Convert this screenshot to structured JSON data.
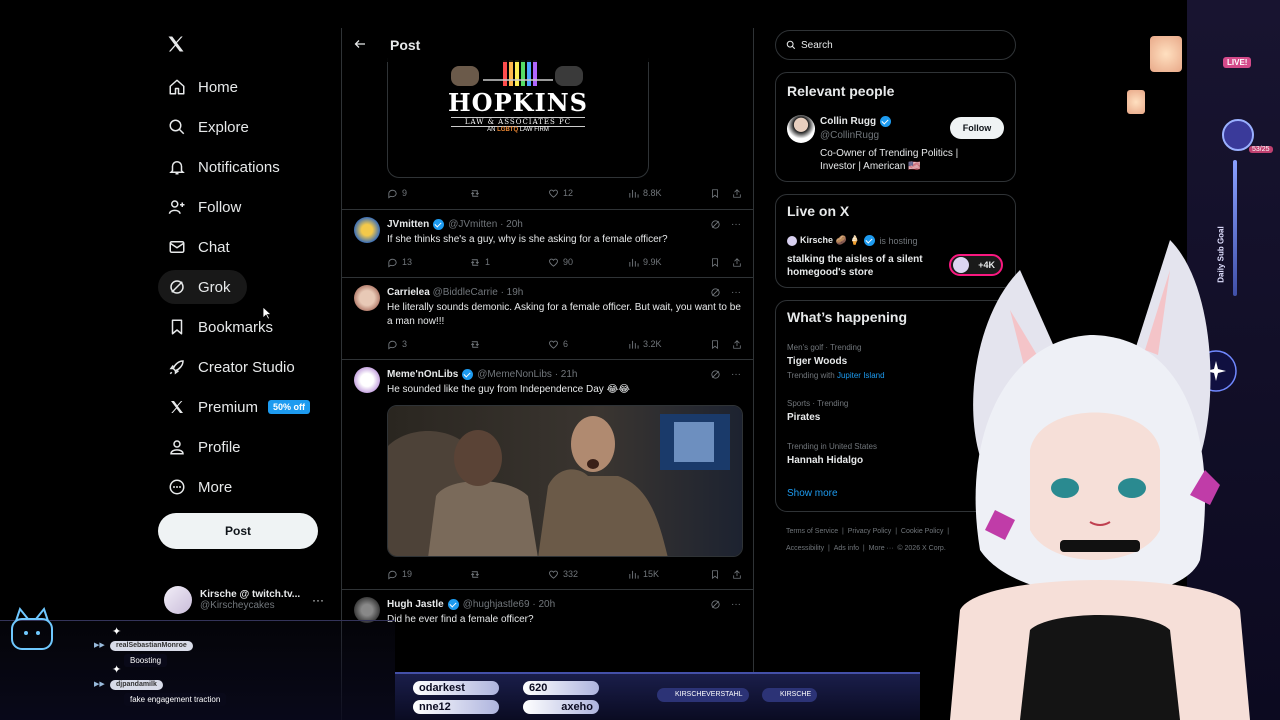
{
  "nav": {
    "items": [
      {
        "label": "Home",
        "icon": "home-icon"
      },
      {
        "label": "Explore",
        "icon": "search-icon"
      },
      {
        "label": "Notifications",
        "icon": "bell-icon"
      },
      {
        "label": "Follow",
        "icon": "add-person-icon"
      },
      {
        "label": "Chat",
        "icon": "envelope-icon"
      },
      {
        "label": "Grok",
        "icon": "grok-icon"
      },
      {
        "label": "Bookmarks",
        "icon": "bookmark-icon"
      },
      {
        "label": "Creator Studio",
        "icon": "rocket-icon"
      },
      {
        "label": "Premium",
        "icon": "x-logo-icon",
        "badge": "50% off"
      },
      {
        "label": "Profile",
        "icon": "person-icon"
      },
      {
        "label": "More",
        "icon": "more-circle-icon"
      }
    ],
    "post_label": "Post",
    "account": {
      "name": "Kirsche @ twitch.tv...",
      "handle": "@Kirscheycakes",
      "more": "···"
    }
  },
  "main": {
    "title": "Post",
    "hero_logo": {
      "word": "HOPKINS",
      "sub": "LAW & ASSOCIATES PC",
      "tag_a": "AN ",
      "tag_b": "LGBTQ",
      "tag_c": " LAW FIRM"
    },
    "hero_actions": {
      "replies": "9",
      "reposts": "",
      "likes": "12",
      "views": "8.8K"
    },
    "tweets": [
      {
        "name": "JVmitten",
        "handle": "@JVmitten",
        "time": "· 20h",
        "text": "If she thinks she's a guy, why is she asking for a female officer?",
        "replies": "13",
        "reposts": "1",
        "likes": "90",
        "views": "9.9K"
      },
      {
        "name": "Carrielea",
        "handle": "@BiddleCarrie",
        "time": "· 19h",
        "text": "He literally sounds demonic. Asking for a female officer. But wait, you want to be a man now!!!",
        "replies": "3",
        "reposts": "",
        "likes": "6",
        "views": "3.2K"
      },
      {
        "name": "Meme'nOnLibs",
        "handle": "@MemeNonLibs",
        "time": "· 21h",
        "text": "He sounded like the guy from Independence Day 😂😂",
        "replies": "19",
        "reposts": "",
        "likes": "332",
        "views": "15K"
      },
      {
        "name": "Hugh Jastle",
        "handle": "@hughjastle69",
        "time": "· 20h",
        "text": "Did he ever find a female officer?"
      }
    ]
  },
  "side": {
    "search_placeholder": "Search",
    "relevant": {
      "title": "Relevant people",
      "name": "Collin Rugg",
      "handle": "@CollinRugg",
      "follow": "Follow",
      "bio": "Co-Owner of Trending Politics | Investor | American 🇺🇸"
    },
    "live": {
      "title": "Live on X",
      "host": "Kirsche 🥔 🍦",
      "is_hosting": "is hosting",
      "stream": "stalking the aisles of a silent homegood's store",
      "count": "+4K"
    },
    "happening": {
      "title": "What’s happening",
      "trends": [
        {
          "cat": "Men's golf · Trending",
          "name": "Tiger Woods",
          "with_label": "Trending with ",
          "with_link": "Jupiter Island"
        },
        {
          "cat": "Sports · Trending",
          "name": "Pirates"
        },
        {
          "cat": "Trending in United States",
          "name": "Hannah Hidalgo"
        }
      ],
      "show_more": "Show more"
    },
    "footer": [
      "Terms of Service",
      "|",
      "Privacy Policy",
      "|",
      "Cookie Policy",
      "|",
      "Accessibility",
      "|",
      "Ads info",
      "|",
      "More ···",
      "© 2026 X Corp."
    ]
  },
  "overlay": {
    "chat": [
      {
        "user": "realSebastianMonroe",
        "msg": "Boosting"
      },
      {
        "user": "djpandamilk",
        "msg": "fake engagement traction"
      }
    ],
    "ticker": [
      "odarkest",
      "620",
      "nne12",
      "axeho"
    ],
    "socials": [
      "KIRSCHEVERSTAHL",
      "KIRSCHE"
    ],
    "live_badge": "LIVE!",
    "sub_goal": "Daily Sub Goal",
    "sub_count": "53/25"
  }
}
